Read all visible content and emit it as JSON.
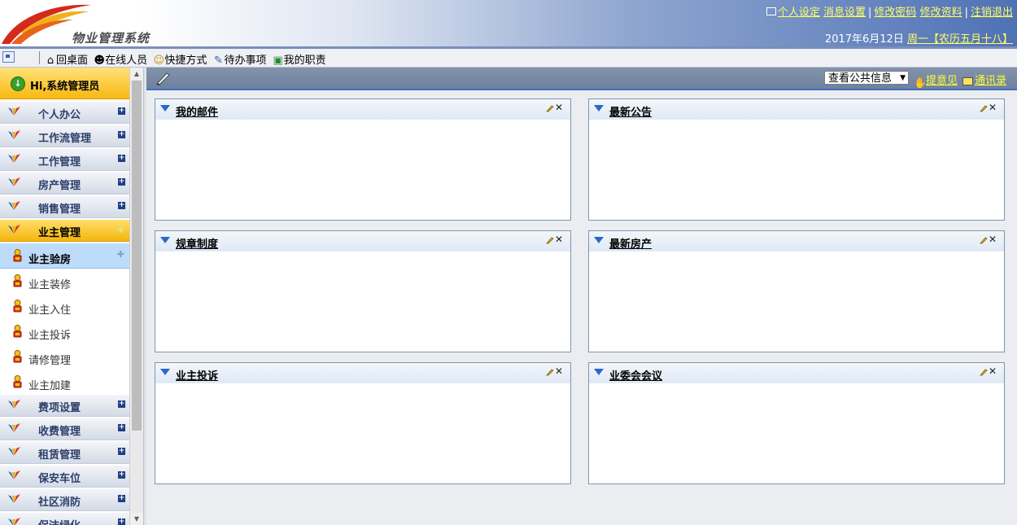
{
  "header": {
    "system_name": "物业管理系统",
    "links": [
      "个人设定",
      "消息设置",
      "修改密码",
      "修改资料",
      "注销退出"
    ],
    "date": "2017年6月12日",
    "weekday": "周一",
    "lunar": "【农历五月十八】"
  },
  "toolbar": {
    "items": [
      {
        "label": "回桌面",
        "icon": "home-icon"
      },
      {
        "label": "在线人员",
        "icon": "online-users-icon"
      },
      {
        "label": "快捷方式",
        "icon": "smiley-icon"
      },
      {
        "label": "待办事项",
        "icon": "todo-icon"
      },
      {
        "label": "我的职责",
        "icon": "duty-icon"
      }
    ]
  },
  "sidebar": {
    "greeting": "Hi,系统管理员",
    "groups_top": [
      {
        "label": "个人办公"
      },
      {
        "label": "工作流管理"
      },
      {
        "label": "工作管理"
      },
      {
        "label": "房产管理"
      },
      {
        "label": "销售管理"
      },
      {
        "label": "业主管理",
        "active": true
      }
    ],
    "sub_items": [
      {
        "label": "业主验房",
        "active": true
      },
      {
        "label": "业主装修"
      },
      {
        "label": "业主入住"
      },
      {
        "label": "业主投诉"
      },
      {
        "label": "请修管理"
      },
      {
        "label": "业主加建"
      }
    ],
    "groups_bottom": [
      {
        "label": "费项设置"
      },
      {
        "label": "收费管理"
      },
      {
        "label": "租赁管理"
      },
      {
        "label": "保安车位"
      },
      {
        "label": "社区消防"
      },
      {
        "label": "保洁绿化"
      }
    ]
  },
  "content_bar": {
    "select_value": "查看公共信息",
    "link_feedback": "提意见",
    "link_contacts": "通讯录"
  },
  "panels": [
    {
      "title": "我的邮件"
    },
    {
      "title": "最新公告"
    },
    {
      "title": "规章制度"
    },
    {
      "title": "最新房产"
    },
    {
      "title": "业主投诉"
    },
    {
      "title": "业委会会议"
    }
  ],
  "colors": {
    "header_blue": "#4f72b6",
    "link_yellow": "#ffff66",
    "active_orange": "#f4b50d",
    "panel_border": "#7d96b4"
  }
}
